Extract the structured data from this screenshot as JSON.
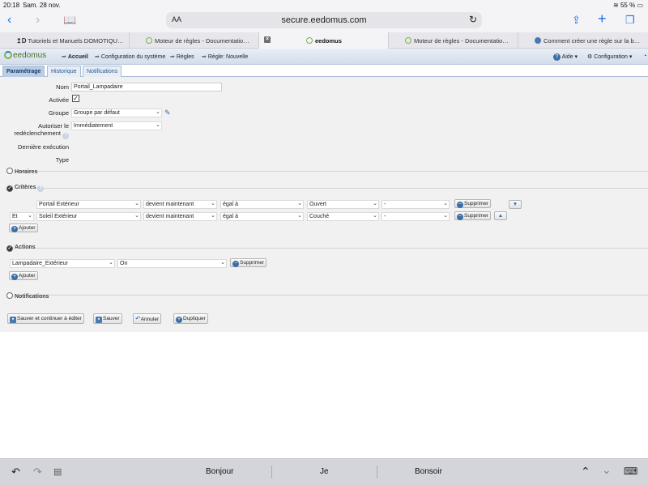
{
  "status": {
    "time": "20:18",
    "date": "Sam. 28 nov.",
    "battery": "55 %"
  },
  "browser": {
    "aa_label": "AA",
    "url": "secure.eedomus.com",
    "tabs": [
      {
        "label": "Tutoriels et Manuels DOMOTIQU…"
      },
      {
        "label": "Moteur de règles - Documentatio…"
      },
      {
        "label": "eedomus"
      },
      {
        "label": "Moteur de règles - Documentatio…"
      },
      {
        "label": "Comment créer une règle sur la b…"
      }
    ]
  },
  "app": {
    "logo": "eedomus",
    "breadcrumb": [
      "Accueil",
      "Configuration du système",
      "Règles",
      "Règle: Nouvelle"
    ],
    "help_label": "Aide",
    "config_label": "Configuration",
    "subtabs": [
      "Paramétrage",
      "Historique",
      "Notifications"
    ]
  },
  "form": {
    "nom_label": "Nom",
    "nom_value": "Portail_Lampadaire",
    "activee_label": "Activée",
    "activee_checked": "✓",
    "groupe_label": "Groupe",
    "groupe_value": "Groupe par défaut",
    "autoriser_label_1": "Autoriser le",
    "autoriser_label_2": "redéclenchement",
    "autoriser_value": "Immédiatement",
    "derniere_label": "Dernière exécution",
    "type_label": "Type"
  },
  "sections": {
    "horaires": "Horaires",
    "criteres": "Critères",
    "actions": "Actions",
    "notifications": "Notifications"
  },
  "criteria": [
    {
      "connector": "",
      "device": "Portail Extérieur",
      "condition": "devient maintenant",
      "operator": "égal à",
      "value": "Ouvert",
      "extra": "-",
      "delete": "Supprimer"
    },
    {
      "connector": "Et",
      "device": "Soleil Extérieur",
      "condition": "devient maintenant",
      "operator": "égal à",
      "value": "Couché",
      "extra": "-",
      "delete": "Supprimer"
    }
  ],
  "actions": [
    {
      "device": "Lampadaire_Extérieur",
      "value": "On",
      "delete": "Supprimer"
    }
  ],
  "add_label": "Ajouter",
  "bottom_buttons": {
    "save_continue": "Sauver et continuer à éditer",
    "save": "Sauver",
    "cancel": "Annuler",
    "duplicate": "Dupliquer"
  },
  "keyboard": {
    "suggestions": [
      "Bonjour",
      "Je",
      "Bonsoir"
    ]
  },
  "colors": {
    "accent": "#1a73e8",
    "nav": "#d3ddea",
    "content_bg": "#f1f1f1"
  }
}
